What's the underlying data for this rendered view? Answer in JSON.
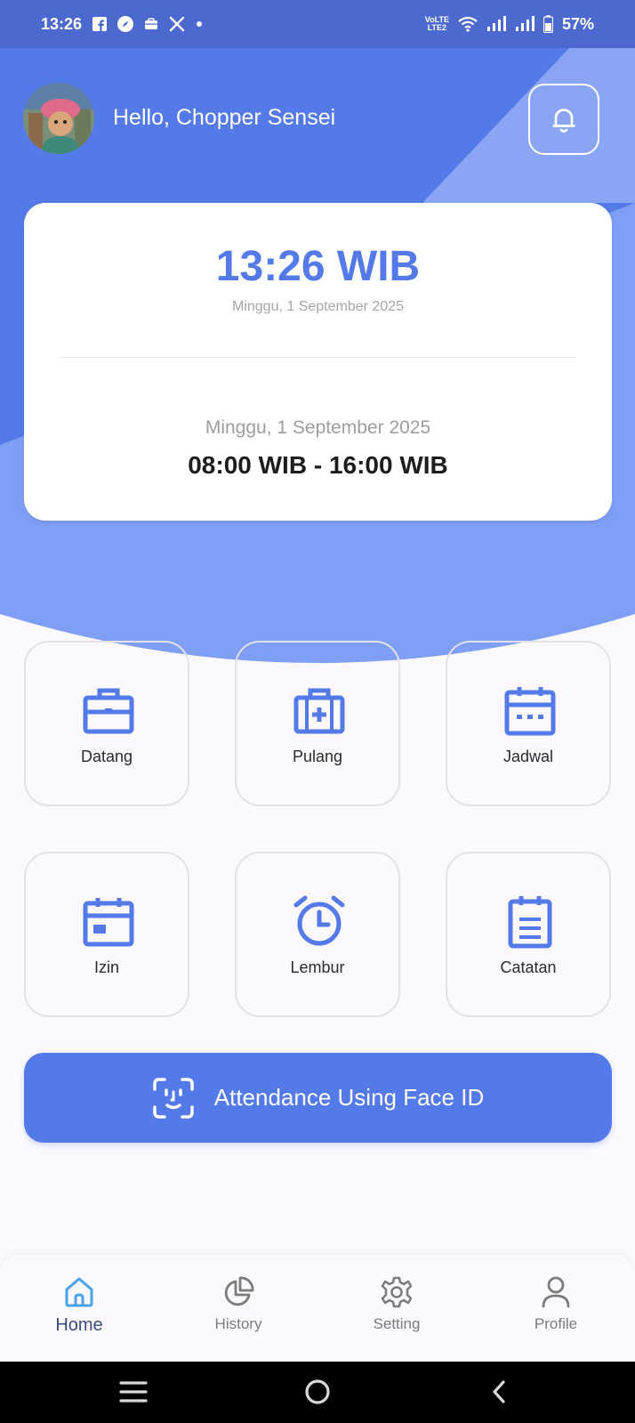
{
  "status_bar": {
    "time": "13:26",
    "battery": "57%",
    "network_label": "LTE2",
    "left_icons": [
      "facebook-icon",
      "compass-icon",
      "briefcase-icon",
      "x-icon",
      "dot-icon"
    ],
    "right_icons": [
      "volte-icon",
      "wifi-icon",
      "signal-icon",
      "signal-icon",
      "battery-icon"
    ]
  },
  "header": {
    "greeting": "Hello, Chopper Sensei",
    "notification_icon": "bell-icon"
  },
  "time_card": {
    "clock": "13:26 WIB",
    "date": "Minggu, 1 September 2025",
    "shift_date": "Minggu, 1 September 2025",
    "shift_time": "08:00 WIB - 16:00 WIB"
  },
  "menu": [
    {
      "label": "Datang",
      "icon": "briefcase-icon"
    },
    {
      "label": "Pulang",
      "icon": "medical-briefcase-icon"
    },
    {
      "label": "Jadwal",
      "icon": "calendar-dots-icon"
    },
    {
      "label": "Izin",
      "icon": "calendar-icon"
    },
    {
      "label": "Lembur",
      "icon": "alarm-clock-icon"
    },
    {
      "label": "Catatan",
      "icon": "clipboard-icon"
    }
  ],
  "face_id_button": {
    "label": "Attendance Using Face ID",
    "icon": "face-id-icon"
  },
  "bottom_nav": [
    {
      "label": "Home",
      "icon": "home-icon",
      "active": true
    },
    {
      "label": "History",
      "icon": "pie-chart-icon",
      "active": false
    },
    {
      "label": "Setting",
      "icon": "gear-icon",
      "active": false
    },
    {
      "label": "Profile",
      "icon": "user-icon",
      "active": false
    }
  ],
  "system_nav": [
    "recents-icon",
    "home-circle-icon",
    "back-icon"
  ],
  "colors": {
    "primary": "#5479e8",
    "hero_light": "#7f9ef5",
    "status_bar": "#4c69cf",
    "background": "#fbf9fd",
    "active_nav": "#3d4b7a"
  }
}
